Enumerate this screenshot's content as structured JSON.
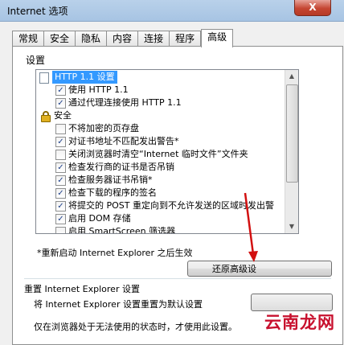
{
  "window": {
    "title": "Internet 选项",
    "close_glyph": "X"
  },
  "tabs": [
    {
      "label": "常规"
    },
    {
      "label": "安全"
    },
    {
      "label": "隐私"
    },
    {
      "label": "内容"
    },
    {
      "label": "连接"
    },
    {
      "label": "程序"
    },
    {
      "label": "高级",
      "active": true
    }
  ],
  "settings": {
    "label": "设置",
    "items": [
      {
        "type": "header",
        "icon": "page-icon",
        "text": "HTTP 1.1 设置"
      },
      {
        "type": "checkbox",
        "checked": true,
        "text": "使用 HTTP 1.1"
      },
      {
        "type": "checkbox",
        "checked": true,
        "text": "通过代理连接使用 HTTP 1.1"
      },
      {
        "type": "category",
        "icon": "lock-icon",
        "text": "安全"
      },
      {
        "type": "checkbox",
        "checked": false,
        "text": "不将加密的页存盘"
      },
      {
        "type": "checkbox",
        "checked": true,
        "text": "对证书地址不匹配发出警告*"
      },
      {
        "type": "checkbox",
        "checked": false,
        "text": "关闭浏览器时清空“Internet 临时文件”文件夹"
      },
      {
        "type": "checkbox",
        "checked": true,
        "text": "检查发行商的证书是否吊销"
      },
      {
        "type": "checkbox",
        "checked": true,
        "text": "检查服务器证书吊销*"
      },
      {
        "type": "checkbox",
        "checked": true,
        "text": "检查下载的程序的签名"
      },
      {
        "type": "checkbox",
        "checked": true,
        "text": "将提交的 POST 重定向到不允许发送的区域时发出警"
      },
      {
        "type": "checkbox",
        "checked": true,
        "text": "启用 DOM 存储"
      },
      {
        "type": "checkbox",
        "checked": false,
        "text": "启用 SmartScreen 筛选器"
      }
    ]
  },
  "note": "*重新启动 Internet Explorer 之后生效",
  "restore_button": "还原高级设",
  "reset": {
    "label": "重置 Internet Explorer 设置",
    "description": "将 Internet Explorer 设置重置为默认设置",
    "description2": "仅在浏览器处于无法使用的状态时，才使用此设置。"
  },
  "watermark": "云南龙网",
  "colors": {
    "selection": "#3399ff",
    "arrow": "#d21010",
    "close": "#c54632"
  }
}
